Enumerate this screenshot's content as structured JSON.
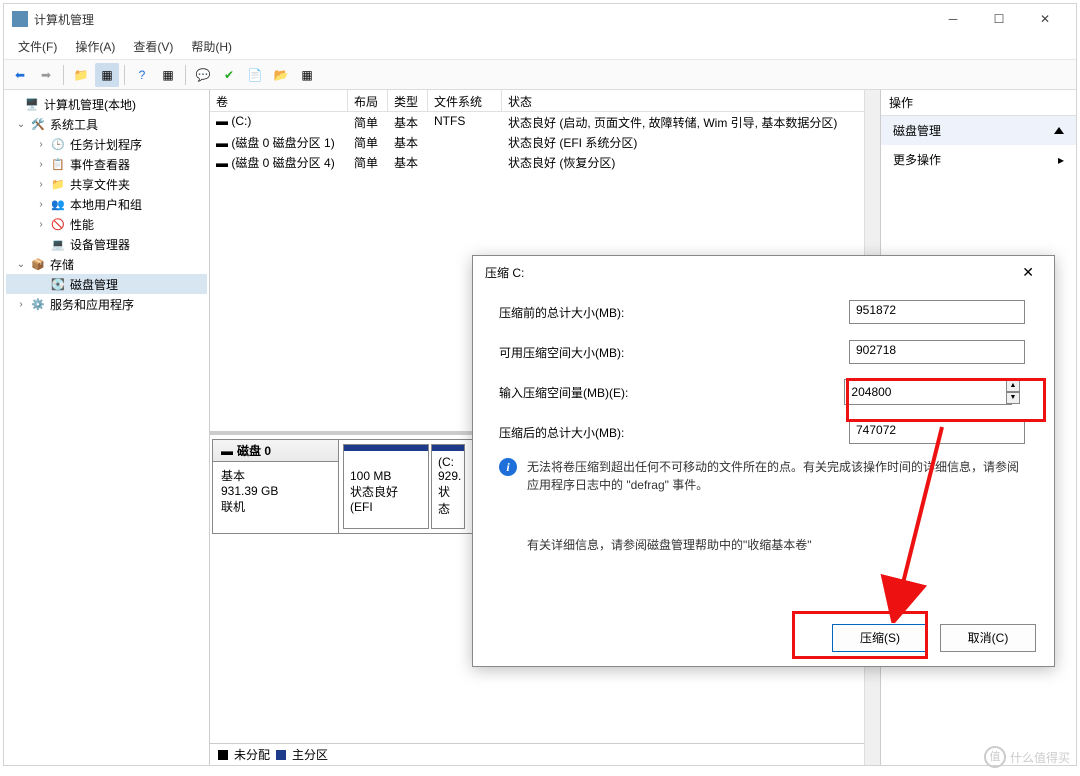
{
  "window": {
    "title": "计算机管理"
  },
  "menubar": [
    "文件(F)",
    "操作(A)",
    "查看(V)",
    "帮助(H)"
  ],
  "tree": {
    "root": "计算机管理(本地)",
    "nodes": [
      {
        "label": "系统工具",
        "icon": "🛠️",
        "expanded": true,
        "children": [
          {
            "label": "任务计划程序",
            "icon": "🕒"
          },
          {
            "label": "事件查看器",
            "icon": "📋"
          },
          {
            "label": "共享文件夹",
            "icon": "📁"
          },
          {
            "label": "本地用户和组",
            "icon": "👥"
          },
          {
            "label": "性能",
            "icon": "🚫"
          },
          {
            "label": "设备管理器",
            "icon": "💻"
          }
        ]
      },
      {
        "label": "存储",
        "icon": "📦",
        "expanded": true,
        "children": [
          {
            "label": "磁盘管理",
            "icon": "💽",
            "selected": true
          }
        ]
      },
      {
        "label": "服务和应用程序",
        "icon": "⚙️"
      }
    ]
  },
  "volumes": {
    "headers": [
      "卷",
      "布局",
      "类型",
      "文件系统",
      "状态"
    ],
    "rows": [
      {
        "v": "(C:)",
        "l": "简单",
        "t": "基本",
        "fs": "NTFS",
        "s": "状态良好 (启动, 页面文件, 故障转储, Wim 引导, 基本数据分区)"
      },
      {
        "v": "(磁盘 0 磁盘分区 1)",
        "l": "简单",
        "t": "基本",
        "fs": "",
        "s": "状态良好 (EFI 系统分区)"
      },
      {
        "v": "(磁盘 0 磁盘分区 4)",
        "l": "简单",
        "t": "基本",
        "fs": "",
        "s": "状态良好 (恢复分区)"
      }
    ]
  },
  "disk": {
    "name": "磁盘 0",
    "type": "基本",
    "size": "931.39 GB",
    "status": "联机",
    "parts": [
      {
        "size": "100 MB",
        "status": "状态良好 (EFI"
      },
      {
        "name": "(C:",
        "size": "929.",
        "status": "状态"
      }
    ]
  },
  "legend": {
    "unalloc": "未分配",
    "primary": "主分区"
  },
  "actions": {
    "header": "操作",
    "group": "磁盘管理",
    "more": "更多操作"
  },
  "dialog": {
    "title": "压缩 C:",
    "rows": [
      {
        "label": "压缩前的总计大小(MB):",
        "value": "951872"
      },
      {
        "label": "可用压缩空间大小(MB):",
        "value": "902718"
      },
      {
        "label": "输入压缩空间量(MB)(E):",
        "value": "204800",
        "spinner": true
      },
      {
        "label": "压缩后的总计大小(MB):",
        "value": "747072"
      }
    ],
    "info": "无法将卷压缩到超出任何不可移动的文件所在的点。有关完成该操作时间的详细信息，请参阅应用程序日志中的 \"defrag\" 事件。",
    "hint": "有关详细信息，请参阅磁盘管理帮助中的\"收缩基本卷\"",
    "ok": "压缩(S)",
    "cancel": "取消(C)"
  },
  "watermark": "什么值得买"
}
